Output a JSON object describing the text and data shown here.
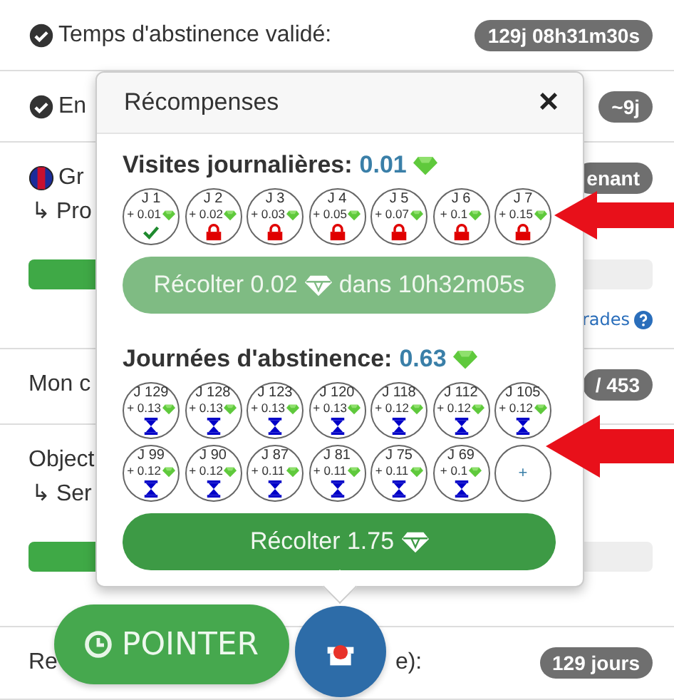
{
  "rows": [
    {
      "validated": true,
      "label": "Temps d'abstinence validé:",
      "badge": "129j 08h31m30s"
    },
    {
      "validated": true,
      "label": "En",
      "badge": "~9j"
    },
    {
      "label": "Gr",
      "sublabel": "↳ Pro",
      "badge": "enant",
      "level": 0.35,
      "footnote": "rades"
    },
    {
      "label": "Mon c",
      "badge": "/ 453"
    },
    {
      "label": "Object",
      "sublabel": "↳ Ser",
      "level": 0.3
    },
    {
      "label": "Re",
      "label_after": "e):",
      "badge": "129 jours"
    }
  ],
  "popover": {
    "title": "Récompenses",
    "close": "×",
    "sections": [
      {
        "title": "Visites journalières:",
        "total": "0.01",
        "days": [
          {
            "day": "J 1",
            "amount": "+ 0.01",
            "kind": "check"
          },
          {
            "day": "J 2",
            "amount": "+ 0.02",
            "kind": "lock"
          },
          {
            "day": "J 3",
            "amount": "+ 0.03",
            "kind": "lock"
          },
          {
            "day": "J 4",
            "amount": "+ 0.05",
            "kind": "lock"
          },
          {
            "day": "J 5",
            "amount": "+ 0.07",
            "kind": "lock"
          },
          {
            "day": "J 6",
            "amount": "+ 0.1",
            "kind": "lock"
          },
          {
            "day": "J 7",
            "amount": "+ 0.15",
            "kind": "lock"
          }
        ],
        "button": {
          "before": "Récolter 0.02",
          "after": "dans 10h32m05s",
          "disabled": true
        }
      },
      {
        "title": "Journées d'abstinence:",
        "total": "0.63",
        "days": [
          {
            "day": "J 129",
            "amount": "+ 0.13",
            "kind": "hourglass"
          },
          {
            "day": "J 128",
            "amount": "+ 0.13",
            "kind": "hourglass"
          },
          {
            "day": "J 123",
            "amount": "+ 0.13",
            "kind": "hourglass"
          },
          {
            "day": "J 120",
            "amount": "+ 0.13",
            "kind": "hourglass"
          },
          {
            "day": "J 118",
            "amount": "+ 0.12",
            "kind": "hourglass"
          },
          {
            "day": "J 112",
            "amount": "+ 0.12",
            "kind": "hourglass"
          },
          {
            "day": "J 105",
            "amount": "+ 0.12",
            "kind": "hourglass"
          },
          {
            "day": "J 99",
            "amount": "+ 0.12",
            "kind": "hourglass"
          },
          {
            "day": "J 90",
            "amount": "+ 0.12",
            "kind": "hourglass"
          },
          {
            "day": "J 87",
            "amount": "+ 0.11",
            "kind": "hourglass"
          },
          {
            "day": "J 81",
            "amount": "+ 0.11",
            "kind": "hourglass"
          },
          {
            "day": "J 75",
            "amount": "+ 0.11",
            "kind": "hourglass"
          },
          {
            "day": "J 69",
            "amount": "+ 0.1",
            "kind": "hourglass"
          },
          {
            "kind": "more",
            "label": "+"
          }
        ],
        "button": {
          "before": "Récolter 1.75",
          "disabled": false
        }
      }
    ]
  },
  "pointer_button": {
    "label": "POINTER"
  }
}
